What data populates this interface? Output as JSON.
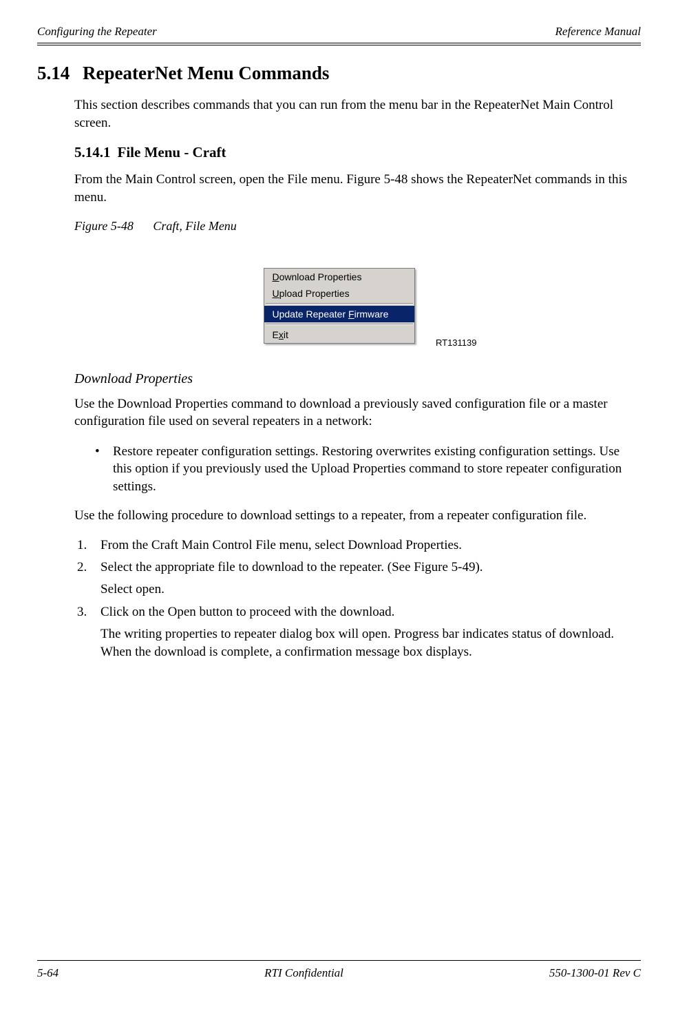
{
  "header": {
    "left": "Configuring the Repeater",
    "right": "Reference Manual"
  },
  "section": {
    "number": "5.14",
    "title": "RepeaterNet Menu Commands",
    "intro": "This section describes commands that you can run from the menu bar in the RepeaterNet Main Control screen."
  },
  "subsection": {
    "number": "5.14.1",
    "title": "File Menu - Craft",
    "intro": "From the Main Control screen, open the File menu. Figure 5-48 shows the RepeaterNet commands in this menu."
  },
  "figure": {
    "label": "Figure 5-48",
    "caption": "Craft, File Menu",
    "image_code": "RT131139",
    "menu": {
      "item1_pre": "D",
      "item1_rest": "ownload Properties",
      "item2_pre": "U",
      "item2_rest": "pload Properties",
      "item3_pre": "Update Repeater ",
      "item3_u": "F",
      "item3_rest": "irmware",
      "item4_pre": "E",
      "item4_u": "x",
      "item4_rest": "it"
    }
  },
  "download": {
    "heading": "Download Properties",
    "para1": "Use the Download Properties command to download a previously saved configuration file or a master configuration file used on several repeaters in a network:",
    "bullet": "Restore repeater configuration settings. Restoring overwrites existing configuration settings. Use this option if you previously used the Upload Properties command to store repeater configuration settings.",
    "para2": "Use the following procedure to download settings to a repeater, from a repeater configuration file.",
    "steps": {
      "s1": "From the Craft Main Control File menu, select Download Properties.",
      "s2": "Select the appropriate file to download to the repeater. (See Figure 5-49).",
      "s2b": "Select open.",
      "s3": "Click on the Open button to proceed with the download.",
      "s3b": "The writing properties to repeater dialog box will open. Progress bar indicates status of download. When the download is complete, a confirmation message box displays."
    }
  },
  "footer": {
    "page": "5-64",
    "center": "RTI Confidential",
    "right": "550-1300-01 Rev C"
  }
}
